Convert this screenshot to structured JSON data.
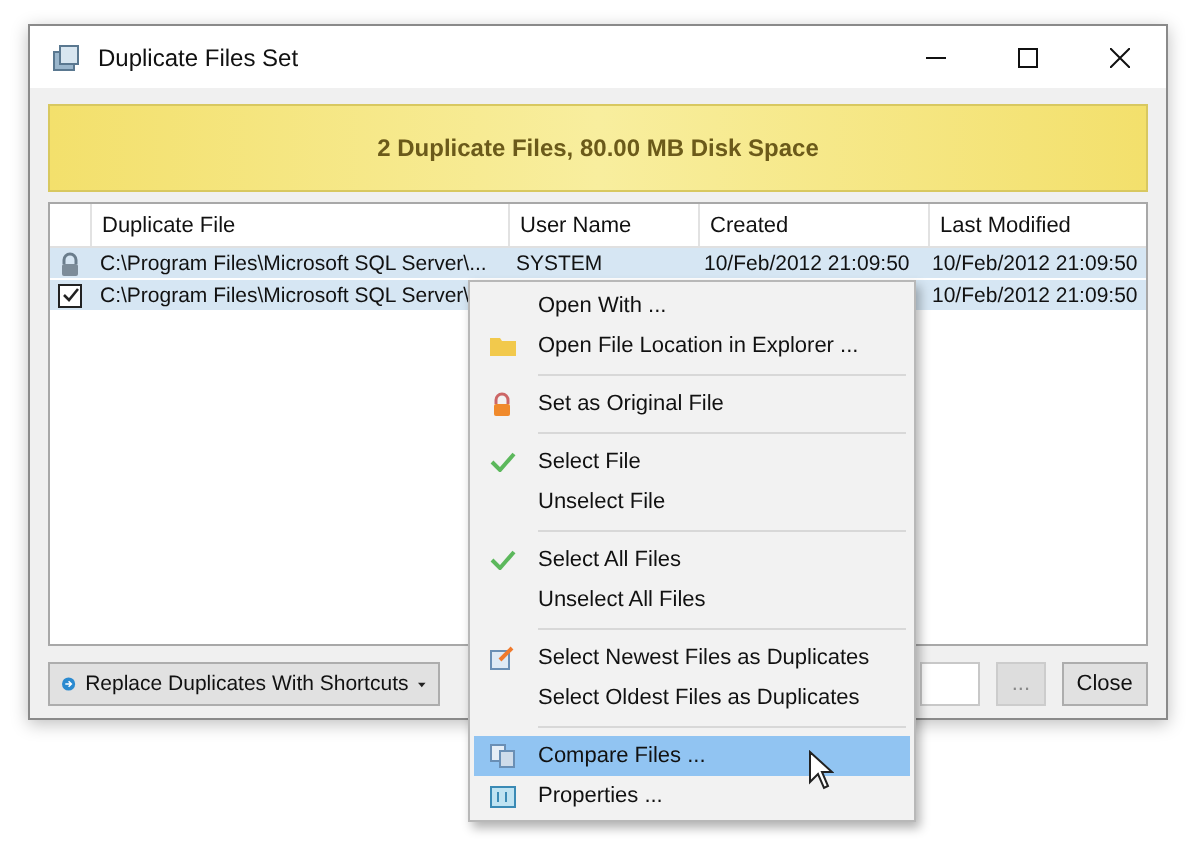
{
  "window": {
    "title": "Duplicate Files Set"
  },
  "banner": {
    "text": "2 Duplicate Files, 80.00 MB Disk Space"
  },
  "table": {
    "columns": [
      "Duplicate File",
      "User Name",
      "Created",
      "Last Modified"
    ],
    "rows": [
      {
        "kind": "original",
        "selected": true,
        "cells": [
          "C:\\Program Files\\Microsoft SQL Server\\...",
          "SYSTEM",
          "10/Feb/2012 21:09:50",
          "10/Feb/2012 21:09:50"
        ]
      },
      {
        "kind": "duplicate",
        "checked": true,
        "selected": true,
        "cells": [
          "C:\\Program Files\\Microsoft SQL Server\\",
          "",
          "",
          "10/Feb/2012 21:09:50"
        ]
      }
    ]
  },
  "buttons": {
    "replace": "Replace Duplicates With Shortcuts",
    "browse": "...",
    "close": "Close"
  },
  "context_menu": [
    {
      "kind": "plain",
      "label": "Open With ...",
      "selected": false
    },
    {
      "kind": "folder",
      "label": "Open File Location in Explorer ...",
      "selected": false
    },
    {
      "kind": "separator"
    },
    {
      "kind": "lock",
      "label": "Set as Original File",
      "selected": false
    },
    {
      "kind": "separator"
    },
    {
      "kind": "check",
      "label": "Select File",
      "selected": false
    },
    {
      "kind": "plain",
      "label": "Unselect File",
      "selected": false
    },
    {
      "kind": "separator"
    },
    {
      "kind": "check",
      "label": "Select All Files",
      "selected": false
    },
    {
      "kind": "plain",
      "label": "Unselect All Files",
      "selected": false
    },
    {
      "kind": "separator"
    },
    {
      "kind": "edit",
      "label": "Select Newest Files as Duplicates",
      "selected": false
    },
    {
      "kind": "plain",
      "label": "Select Oldest Files as Duplicates",
      "selected": false
    },
    {
      "kind": "separator"
    },
    {
      "kind": "compare",
      "label": "Compare Files ...",
      "selected": true
    },
    {
      "kind": "properties",
      "label": "Properties ...",
      "selected": false
    }
  ]
}
